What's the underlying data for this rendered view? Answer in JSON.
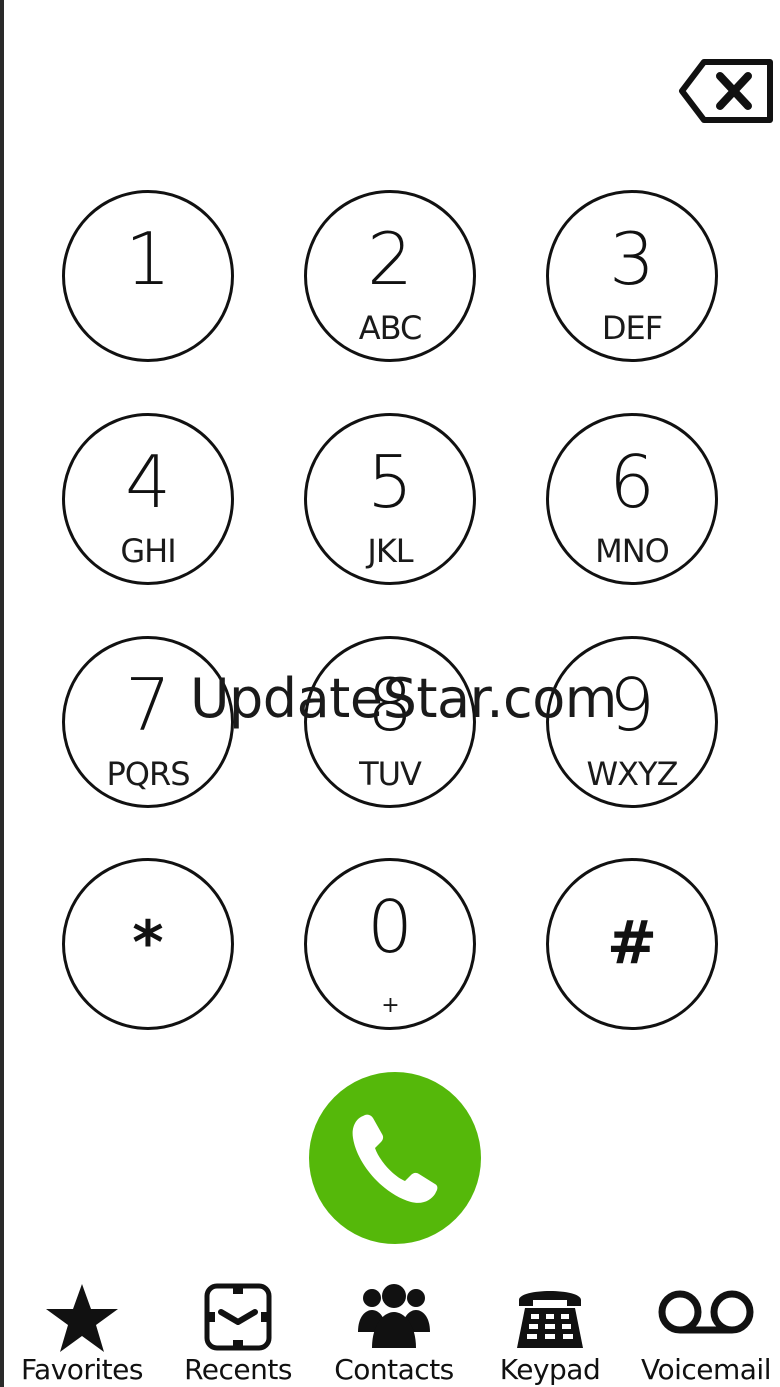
{
  "keypad": {
    "keys": [
      {
        "digit": "1",
        "letters": ""
      },
      {
        "digit": "2",
        "letters": "ABC"
      },
      {
        "digit": "3",
        "letters": "DEF"
      },
      {
        "digit": "4",
        "letters": "GHI"
      },
      {
        "digit": "5",
        "letters": "JKL"
      },
      {
        "digit": "6",
        "letters": "MNO"
      },
      {
        "digit": "7",
        "letters": "PQRS"
      },
      {
        "digit": "8",
        "letters": "TUV"
      },
      {
        "digit": "9",
        "letters": "WXYZ"
      },
      {
        "digit": "*",
        "letters": ""
      },
      {
        "digit": "0",
        "letters": "+"
      },
      {
        "digit": "#",
        "letters": ""
      }
    ]
  },
  "call_button": {
    "color": "#55b80a",
    "icon": "phone-icon"
  },
  "backspace": {
    "icon": "backspace-icon"
  },
  "watermark": {
    "text": "UpdateStar.com"
  },
  "tabs": [
    {
      "label": "Favorites",
      "icon": "star-icon"
    },
    {
      "label": "Recents",
      "icon": "clock-icon"
    },
    {
      "label": "Contacts",
      "icon": "contacts-icon"
    },
    {
      "label": "Keypad",
      "icon": "keypad-icon"
    },
    {
      "label": "Voicemail",
      "icon": "voicemail-icon"
    }
  ]
}
